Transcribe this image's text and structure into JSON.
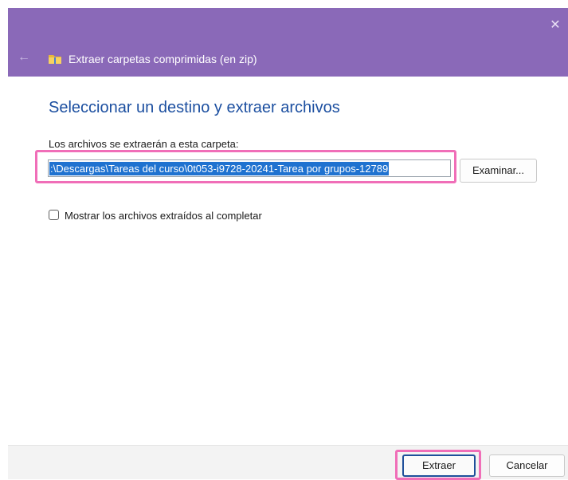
{
  "window": {
    "title": "Extraer carpetas comprimidas (en zip)",
    "close_glyph": "✕",
    "back_glyph": "←"
  },
  "icons": {
    "close": "close-icon",
    "back": "back-arrow-icon",
    "folder": "zip-folder-icon"
  },
  "main": {
    "heading": "Seleccionar un destino y extraer archivos",
    "path_label": "Los archivos se extraerán a esta carpeta:",
    "path_value": ":\\Descargas\\Tareas del curso\\0t053-i9728-20241-Tarea por grupos-12789",
    "browse_label": "Examinar...",
    "show_files_label": "Mostrar los archivos extraídos al completar",
    "show_files_checked": false
  },
  "footer": {
    "extract_label": "Extraer",
    "cancel_label": "Cancelar"
  },
  "colors": {
    "titlebar": "#8a69b8",
    "heading": "#1c4fa0",
    "selection": "#1f72d0",
    "highlight": "#f06eb8",
    "default_button_border": "#1f4f9a"
  }
}
